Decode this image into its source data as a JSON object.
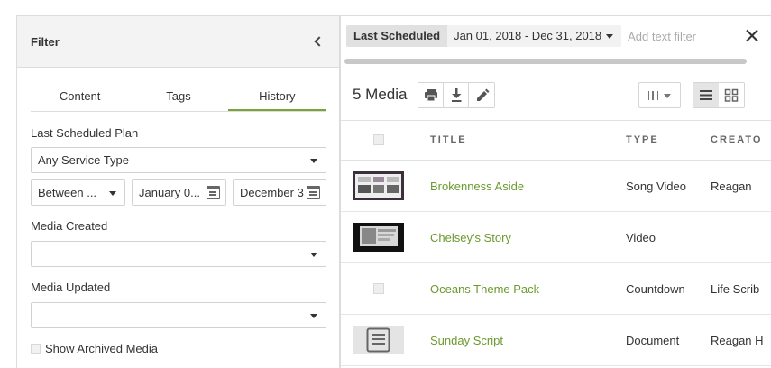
{
  "filter": {
    "title": "Filter",
    "tabs": [
      {
        "label": "Content",
        "active": false
      },
      {
        "label": "Tags",
        "active": false
      },
      {
        "label": "History",
        "active": true
      }
    ],
    "last_scheduled_label": "Last Scheduled Plan",
    "service_type_value": "Any Service Type",
    "range_type_value": "Between ...",
    "start_date_value": "January 0...",
    "end_date_value": "December 3",
    "media_created_label": "Media Created",
    "media_created_value": "",
    "media_updated_label": "Media Updated",
    "media_updated_value": "",
    "show_archived_label": "Show Archived Media"
  },
  "filter_bar": {
    "chip_label": "Last Scheduled",
    "chip_value": "Jan 01, 2018 - Dec 31, 2018",
    "text_filter_placeholder": "Add text filter"
  },
  "media": {
    "count_label": "5 Media",
    "columns": [
      "TITLE",
      "TYPE",
      "CREATO"
    ],
    "rows": [
      {
        "title": "Brokenness Aside",
        "type": "Song Video",
        "creator": "Reagan",
        "thumb": "slides"
      },
      {
        "title": "Chelsey's Story",
        "type": "Video",
        "creator": "",
        "thumb": "video"
      },
      {
        "title": "Oceans Theme Pack",
        "type": "Countdown",
        "creator": "Life Scrib",
        "thumb": "none"
      },
      {
        "title": "Sunday Script",
        "type": "Document",
        "creator": "Reagan H",
        "thumb": "document"
      }
    ]
  },
  "colors": {
    "accent": "#7aa33c",
    "link": "#6b9a2e"
  }
}
